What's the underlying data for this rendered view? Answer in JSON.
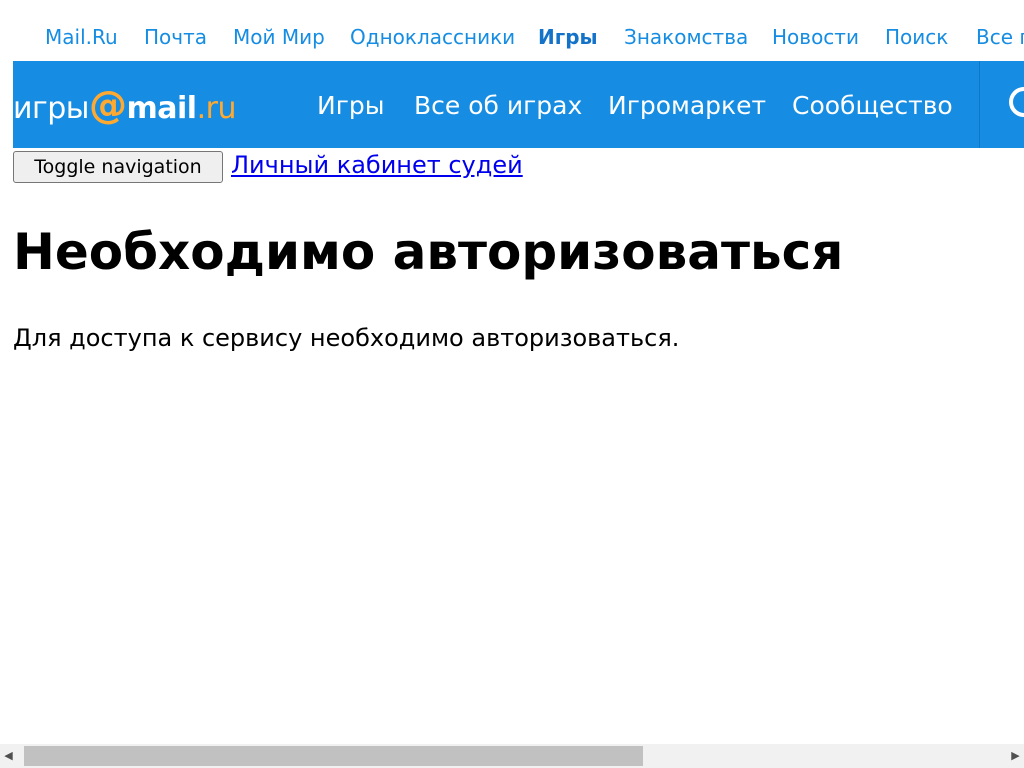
{
  "portal_nav": {
    "items": [
      {
        "label": "Mail.Ru",
        "active": false
      },
      {
        "label": "Почта",
        "active": false
      },
      {
        "label": "Мой Мир",
        "active": false
      },
      {
        "label": "Одноклассники",
        "active": false
      },
      {
        "label": "Игры",
        "active": true
      },
      {
        "label": "Знакомства",
        "active": false
      },
      {
        "label": "Новости",
        "active": false
      },
      {
        "label": "Поиск",
        "active": false
      },
      {
        "label": "Все п",
        "active": false
      }
    ]
  },
  "games_header": {
    "logo": {
      "word": "игры",
      "at": "@",
      "mail": "mail",
      "ru": ".ru"
    },
    "nav": [
      {
        "label": "Игры"
      },
      {
        "label": "Все об играх"
      },
      {
        "label": "Игромаркет"
      },
      {
        "label": "Сообщество"
      }
    ],
    "right_icon": "at-icon"
  },
  "toolbar": {
    "toggle_label": "Toggle navigation",
    "cabinet_link": "Личный кабинет судей"
  },
  "main": {
    "title": "Необходимо авторизоваться",
    "text": "Для доступа к сервису необходимо авторизоваться."
  },
  "colors": {
    "header_blue": "#168de2",
    "logo_accent": "#ffa930",
    "link_blue": "#168de2"
  },
  "scrollbar": {
    "left_arrow_icon": "triangle-left-icon",
    "right_arrow_icon": "triangle-right-icon",
    "thumb_fraction": 0.6
  }
}
